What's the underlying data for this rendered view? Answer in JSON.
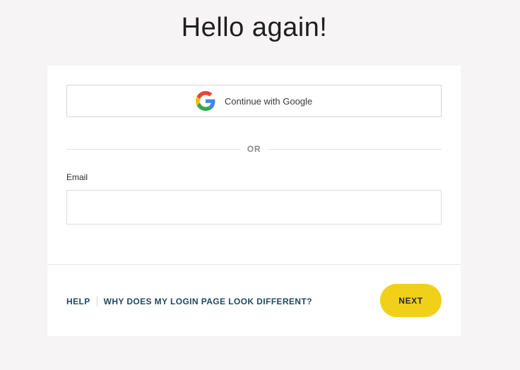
{
  "heading": "Hello again!",
  "google_button": {
    "label": "Continue with Google",
    "icon": "google-g-icon"
  },
  "divider_text": "OR",
  "email": {
    "label": "Email",
    "value": "",
    "placeholder": ""
  },
  "footer": {
    "help_link": "HELP",
    "different_link": "WHY DOES MY LOGIN PAGE LOOK DIFFERENT?",
    "next_button": "NEXT"
  },
  "colors": {
    "background": "#f6f4f4",
    "card": "#ffffff",
    "accent_yellow": "#f0d018",
    "link": "#1d4a5e"
  }
}
